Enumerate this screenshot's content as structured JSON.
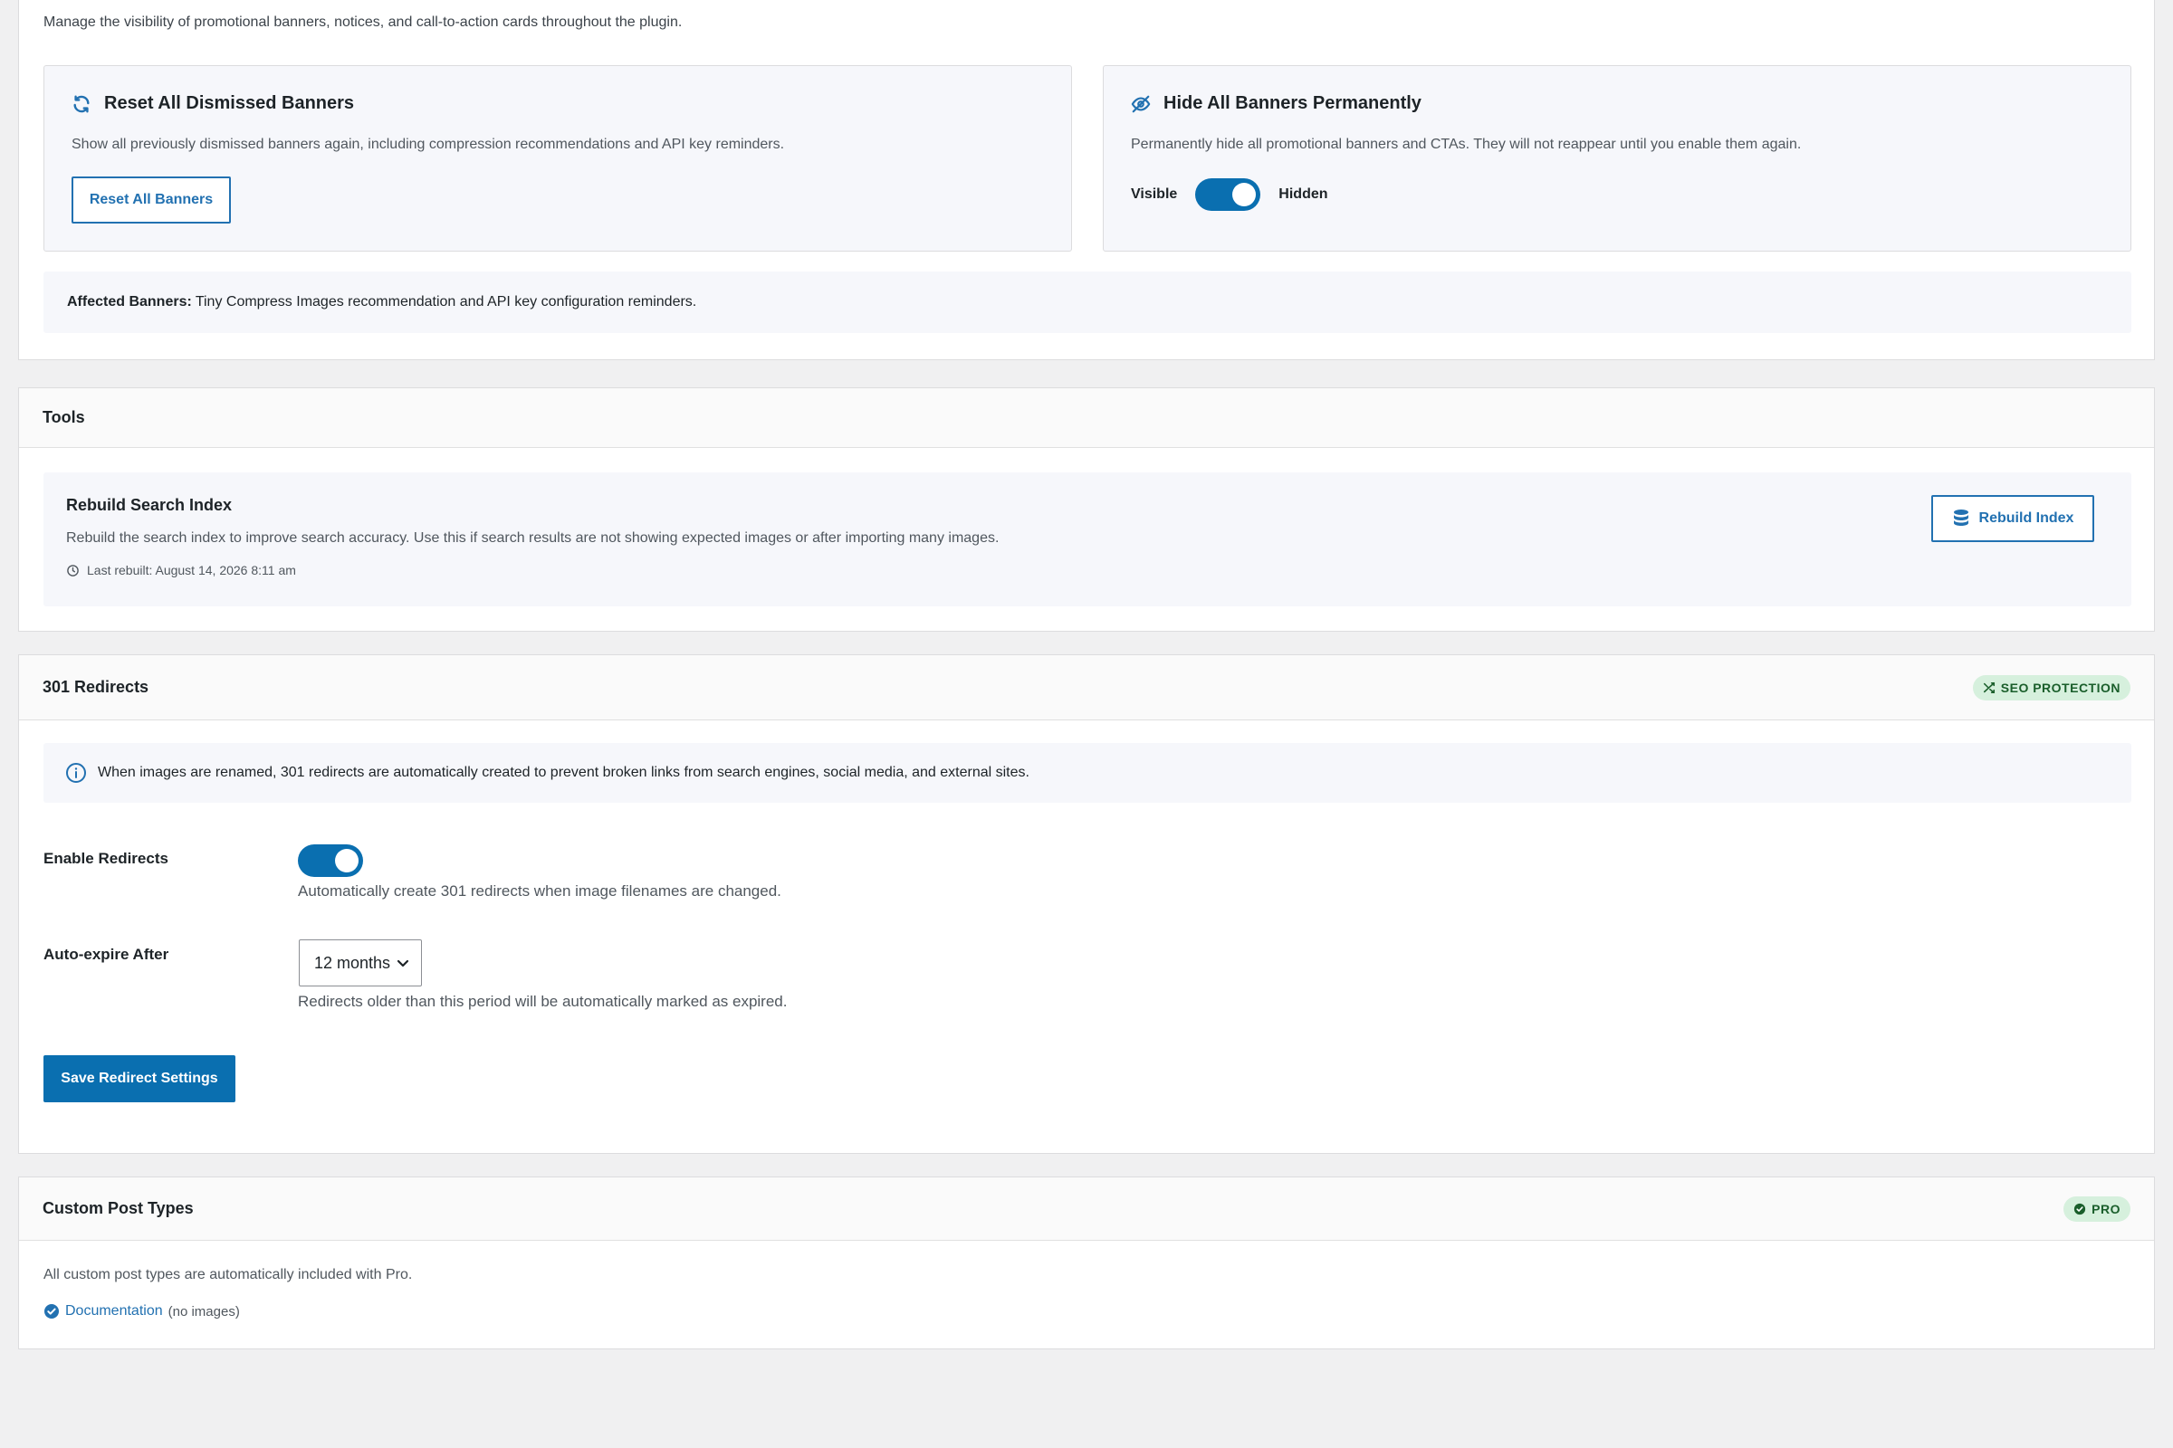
{
  "banners": {
    "intro": "Manage the visibility of promotional banners, notices, and call-to-action cards throughout the plugin.",
    "reset_card": {
      "icon": "refresh-icon",
      "title": "Reset All Dismissed Banners",
      "description": "Show all previously dismissed banners again, including compression recommendations and API key reminders.",
      "button_label": "Reset All Banners"
    },
    "hide_card": {
      "icon": "eye-slash-icon",
      "title": "Hide All Banners Permanently",
      "description": "Permanently hide all promotional banners and CTAs. They will not reappear until you enable them again.",
      "toggle_left_label": "Visible",
      "toggle_right_label": "Hidden",
      "toggle_state": "on"
    },
    "affected_label": "Affected Banners:",
    "affected_text": "Tiny Compress Images recommendation and API key configuration reminders."
  },
  "tools": {
    "title": "Tools",
    "rebuild": {
      "title": "Rebuild Search Index",
      "description": "Rebuild the search index to improve search accuracy. Use this if search results are not showing expected images or after importing many images.",
      "last_rebuilt": "Last rebuilt: August 14, 2026 8:11 am",
      "button_label": "Rebuild Index",
      "button_icon": "database-icon"
    }
  },
  "redirects": {
    "title": "301 Redirects",
    "badge": "SEO PROTECTION",
    "badge_icon": "shuffle-icon",
    "info": "When images are renamed, 301 redirects are automatically created to prevent broken links from search engines, social media, and external sites.",
    "enable_label": "Enable Redirects",
    "enable_state": "on",
    "enable_help": "Automatically create 301 redirects when image filenames are changed.",
    "expire_label": "Auto-expire After",
    "expire_value": "12 months",
    "expire_help": "Redirects older than this period will be automatically marked as expired.",
    "save_label": "Save Redirect Settings"
  },
  "cpt": {
    "title": "Custom Post Types",
    "badge": "PRO",
    "badge_icon": "check-circle-icon",
    "text": "All custom post types are automatically included with Pro.",
    "items": [
      {
        "label": "Documentation",
        "note": "(no images)"
      }
    ]
  },
  "colors": {
    "accent": "#2271b1",
    "toggle_on": "#0a6fb0",
    "badge_bg": "#d6f0dd",
    "badge_text": "#1a5e2b",
    "page_bg": "#f0f0f1"
  }
}
